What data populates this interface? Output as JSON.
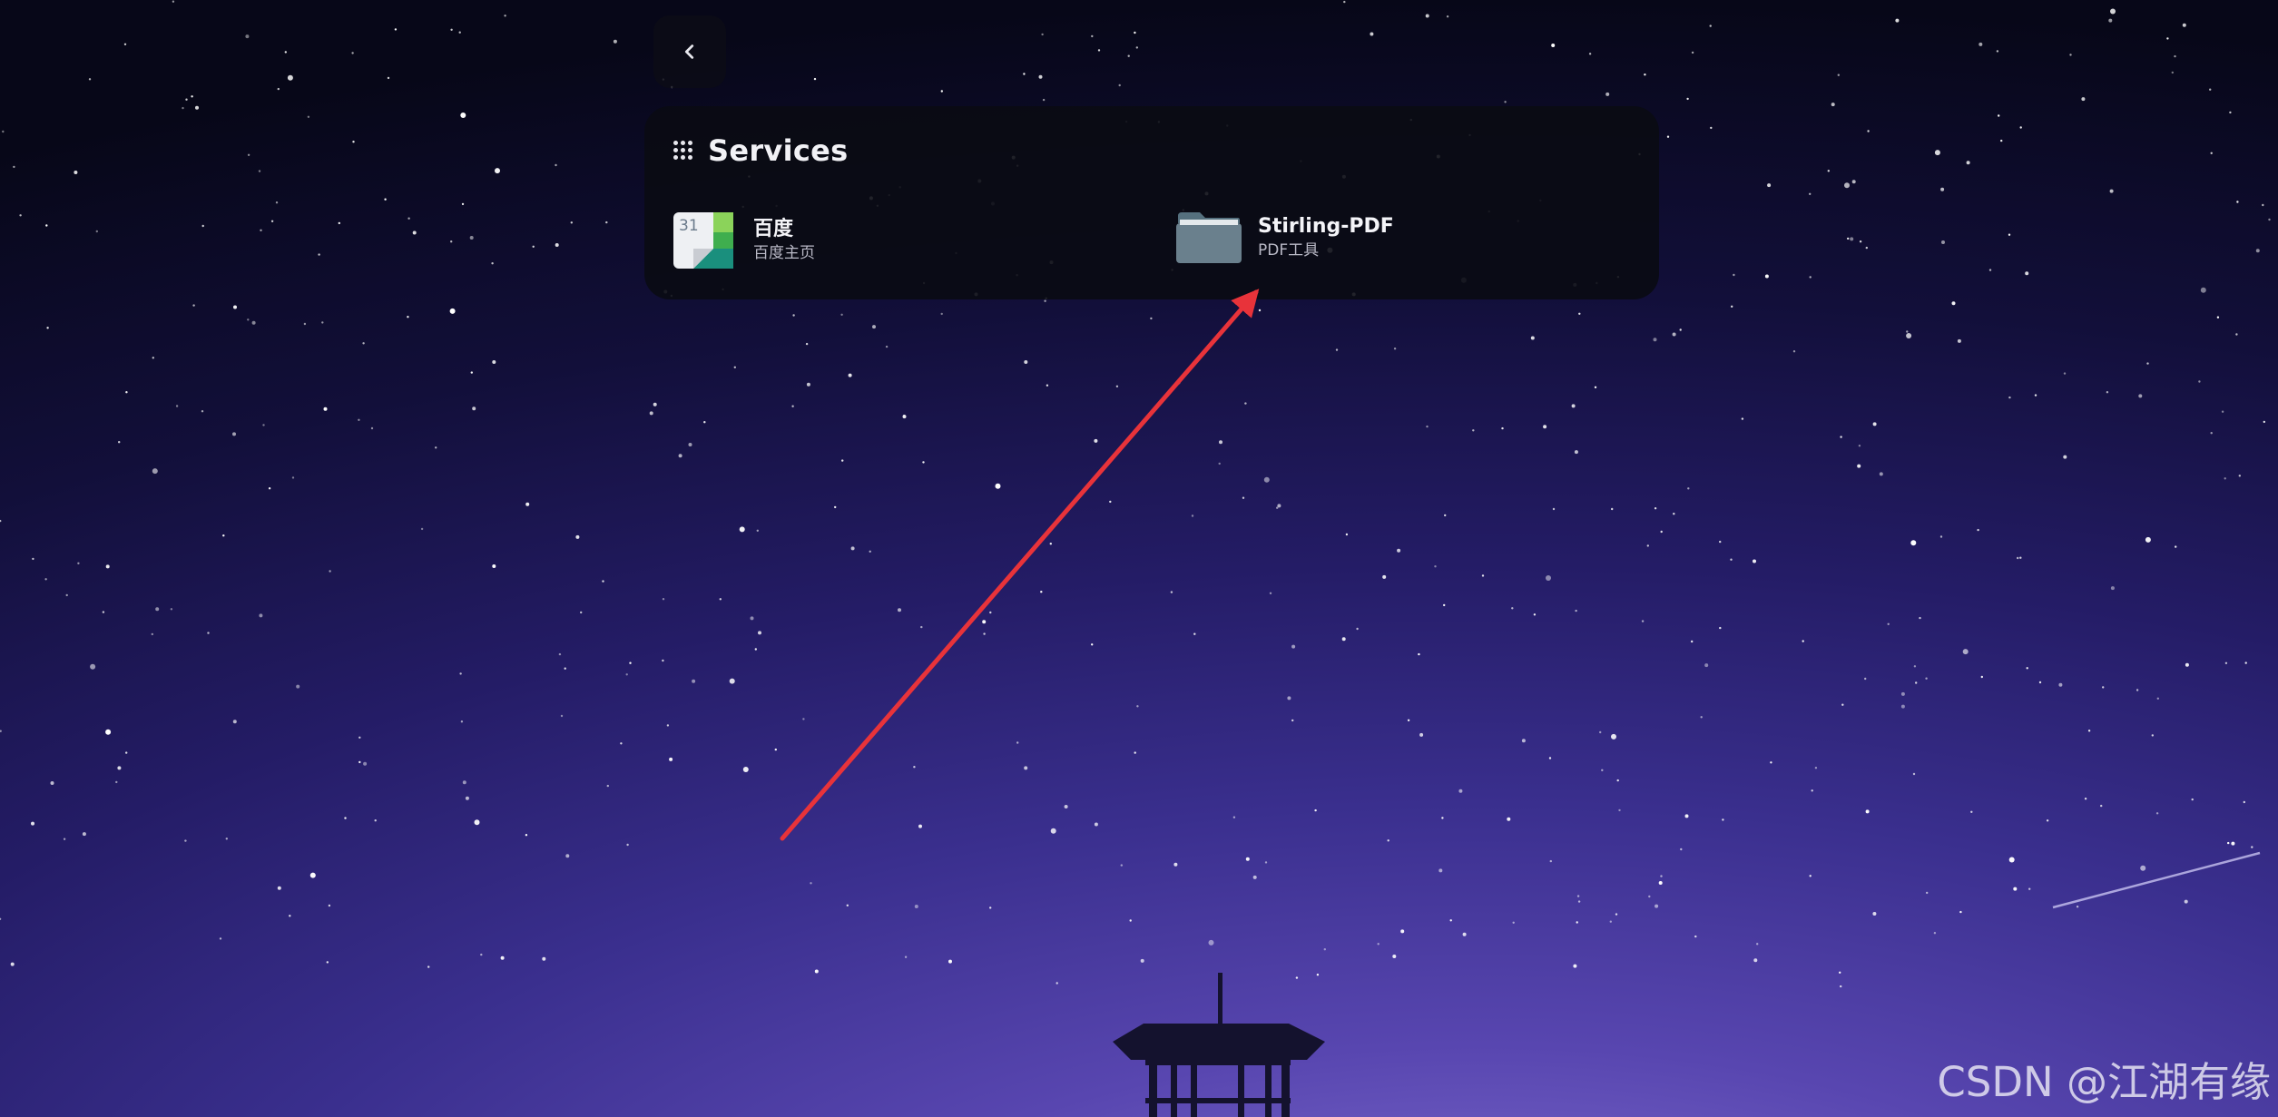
{
  "nav": {
    "back_icon": "chevron-left-icon"
  },
  "services_panel": {
    "icon": "grid-dots-icon",
    "title": "Services",
    "items": [
      {
        "name": "百度",
        "description": "百度主页",
        "icon": "calendar-icon",
        "icon_label": "31"
      },
      {
        "name": "Stirling-PDF",
        "description": "PDF工具",
        "icon": "folder-icon"
      }
    ]
  },
  "annotation": {
    "type": "arrow",
    "color": "#e8333a",
    "points_to": "Stirling-PDF"
  },
  "watermark": "CSDN @江湖有缘",
  "colors": {
    "panel_bg": "#0a0b13",
    "arrow": "#e8333a",
    "folder": "#6a808d"
  }
}
